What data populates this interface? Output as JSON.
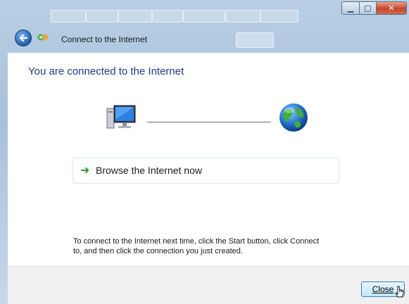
{
  "window": {
    "title": "Connect to the Internet",
    "controls": {
      "minimize": "▁",
      "maximize": "▢",
      "close": "✕"
    }
  },
  "main": {
    "heading": "You are connected to the Internet",
    "browse_label": "Browse the Internet now",
    "hint_text": "To connect to the Internet next time, click the Start button, click Connect to, and then click the connection you just created."
  },
  "footer": {
    "close_label": "Close"
  },
  "icons": {
    "back": "back-arrow-icon",
    "network": "network-icon",
    "computer": "computer-icon",
    "globe": "globe-icon",
    "browse_arrow": "green-arrow-icon"
  },
  "colors": {
    "heading": "#1f3a8a",
    "arrow": "#2a9a2a",
    "close_accent": "#3c7fb1"
  }
}
